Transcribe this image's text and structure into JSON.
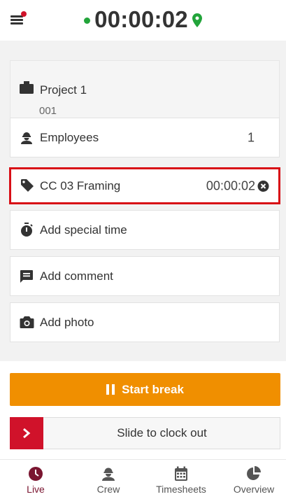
{
  "header": {
    "timer": "00:00:02",
    "status_color": "#22a43a",
    "notification_color": "#d0122a"
  },
  "project": {
    "name": "Project 1",
    "code": "001"
  },
  "employees": {
    "label": "Employees",
    "count": "1"
  },
  "cost_code": {
    "label": "CC 03 Framing",
    "time": "00:00:02"
  },
  "actions": {
    "special_time": "Add special time",
    "comment": "Add comment",
    "photo": "Add photo"
  },
  "break_button": {
    "label": "Start break"
  },
  "clock_out_slider": {
    "label": "Slide to clock out"
  },
  "tabs": [
    {
      "label": "Live",
      "icon": "clock-icon",
      "active": true
    },
    {
      "label": "Crew",
      "icon": "worker-icon",
      "active": false
    },
    {
      "label": "Timesheets",
      "icon": "calendar-icon",
      "active": false
    },
    {
      "label": "Overview",
      "icon": "pie-chart-icon",
      "active": false
    }
  ],
  "colors": {
    "accent_orange": "#f08f00",
    "accent_red": "#d0122a",
    "active_tab": "#7a1530",
    "highlight_border": "#d80f16"
  }
}
